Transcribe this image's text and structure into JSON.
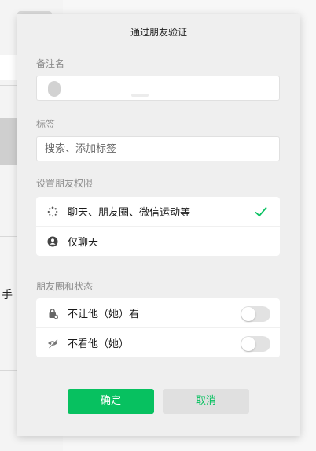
{
  "dialog": {
    "title": "通过朋友验证",
    "remark": {
      "label": "备注名"
    },
    "tags": {
      "label": "标签",
      "placeholder": "搜索、添加标签"
    },
    "permissions": {
      "label": "设置朋友权限",
      "options": [
        {
          "label": "聊天、朋友圈、微信运动等",
          "icon": "loading-spinner-icon",
          "selected": true
        },
        {
          "label": "仅聊天",
          "icon": "person-icon",
          "selected": false
        }
      ]
    },
    "moments": {
      "label": "朋友圈和状态",
      "options": [
        {
          "label": "不让他（她）看",
          "icon": "lock-icon",
          "enabled": false
        },
        {
          "label": "不看他（她）",
          "icon": "eye-off-icon",
          "enabled": false
        }
      ]
    },
    "buttons": {
      "confirm": "确定",
      "cancel": "取消"
    }
  },
  "background": {
    "side_char": "手"
  },
  "colors": {
    "accent": "#07c160",
    "dialog_bg": "#efefef"
  }
}
